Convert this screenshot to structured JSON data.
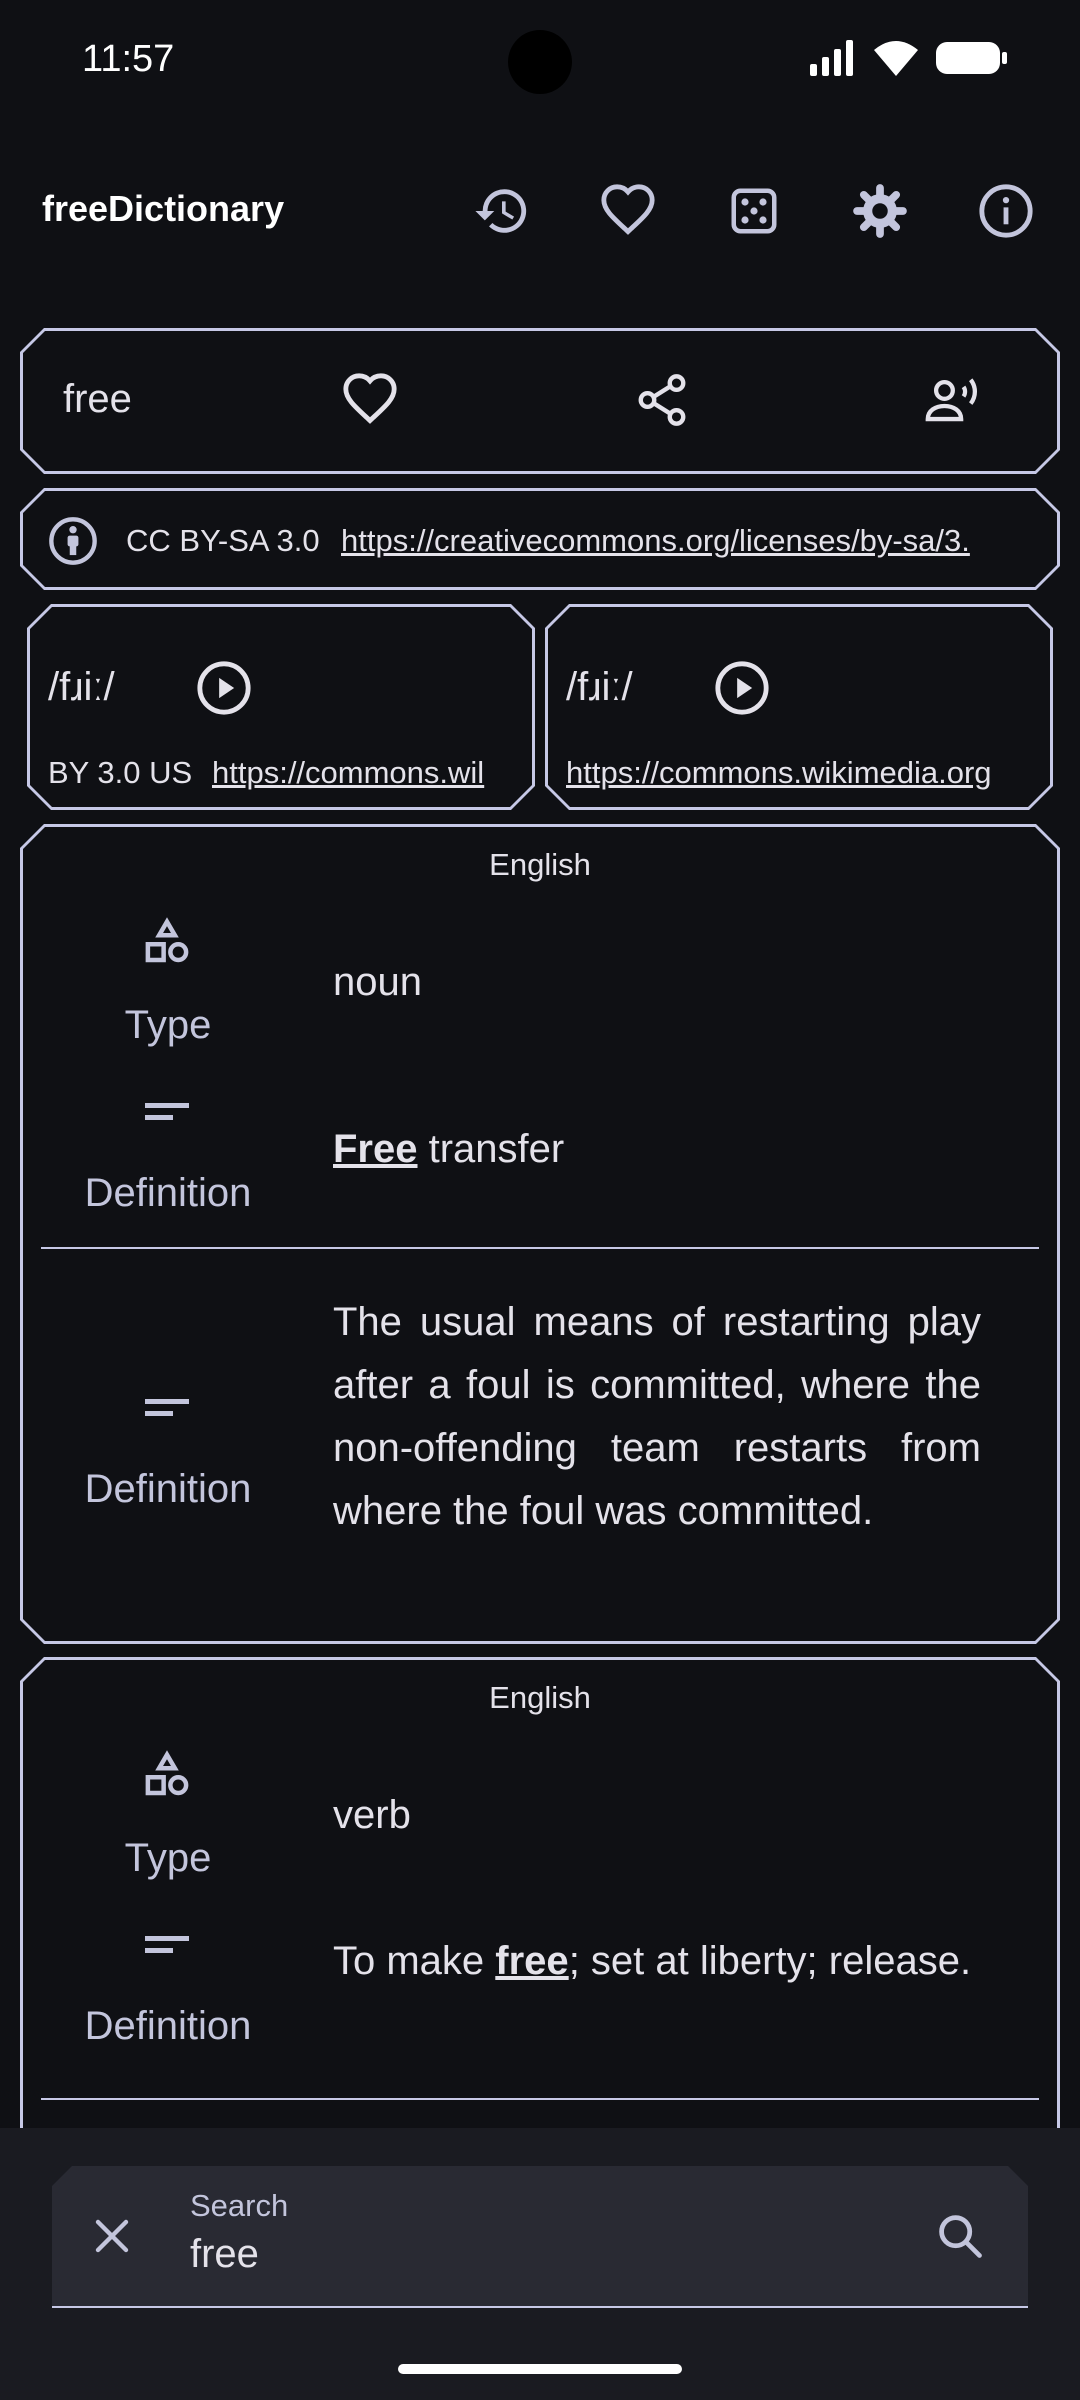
{
  "status_bar": {
    "time": "11:57"
  },
  "app_bar": {
    "title": "freeDictionary",
    "icons": [
      "history-icon",
      "favorite-icon",
      "dice-icon",
      "settings-icon",
      "info-icon"
    ]
  },
  "word_card": {
    "word": "free"
  },
  "license_card": {
    "license": "CC BY-SA 3.0",
    "url": "https://creativecommons.org/licenses/by-sa/3."
  },
  "phonetics": [
    {
      "text": "/fɹiː/",
      "license": "BY 3.0 US",
      "url": "https://commons.wil"
    },
    {
      "text": "/fɹiː/",
      "license": "",
      "url": "https://commons.wikimedia.org"
    }
  ],
  "meanings": [
    {
      "language": "English",
      "type_label": "Type",
      "type": "noun",
      "definition_label": "Definition",
      "definitions": [
        {
          "bold": "Free",
          "rest": " transfer"
        },
        {
          "text": "The usual means of restarting play after a foul is committed, where the non-offending team restarts from where the foul was committed."
        }
      ]
    },
    {
      "language": "English",
      "type_label": "Type",
      "type": "verb",
      "definition_label": "Definition",
      "definitions": [
        {
          "before": "To make ",
          "bold": "free",
          "after": "; set at liberty; release."
        }
      ]
    }
  ],
  "search": {
    "label": "Search",
    "value": "free"
  },
  "colors": {
    "background": "#0f1014",
    "outline": "#c6c8e6",
    "search_bg": "#292a33"
  }
}
